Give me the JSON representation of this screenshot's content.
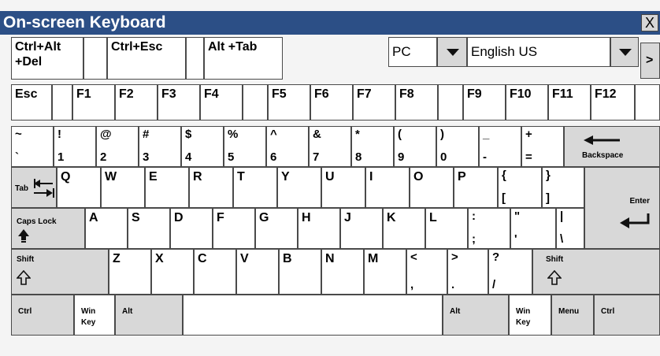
{
  "window": {
    "title": "On-screen Keyboard",
    "close": "X"
  },
  "toolbar": {
    "ctrl_alt_del": "Ctrl+Alt\n+Del",
    "ctrl_esc": "Ctrl+Esc",
    "alt_tab": "Alt +Tab",
    "platform_value": "PC",
    "language_value": "English US",
    "more": ">"
  },
  "frow": [
    "Esc",
    "F1",
    "F2",
    "F3",
    "F4",
    "F5",
    "F6",
    "F7",
    "F8",
    "F9",
    "F10",
    "F11",
    "F12"
  ],
  "num_row": [
    {
      "top": "~",
      "bottom": "`"
    },
    {
      "top": "!",
      "bottom": "1"
    },
    {
      "top": "@",
      "bottom": "2"
    },
    {
      "top": "#",
      "bottom": "3"
    },
    {
      "top": "$",
      "bottom": "4"
    },
    {
      "top": "%",
      "bottom": "5"
    },
    {
      "top": "^",
      "bottom": "6"
    },
    {
      "top": "&",
      "bottom": "7"
    },
    {
      "top": "*",
      "bottom": "8"
    },
    {
      "top": "(",
      "bottom": "9"
    },
    {
      "top": ")",
      "bottom": "0"
    },
    {
      "top": "_",
      "bottom": "-"
    },
    {
      "top": "+",
      "bottom": "="
    }
  ],
  "backspace": "Backspace",
  "tab": "Tab",
  "qrow": [
    "Q",
    "W",
    "E",
    "R",
    "T",
    "Y",
    "U",
    "I",
    "O",
    "P"
  ],
  "bracket_open": {
    "top": "{",
    "bottom": "["
  },
  "bracket_close": {
    "top": "}",
    "bottom": "]"
  },
  "enter": "Enter",
  "caps": "Caps Lock",
  "arow": [
    "A",
    "S",
    "D",
    "F",
    "G",
    "H",
    "J",
    "K",
    "L"
  ],
  "semicolon": {
    "top": ":",
    "bottom": ";"
  },
  "quote": {
    "top": "\"",
    "bottom": "'"
  },
  "backslash": {
    "top": "|",
    "bottom": "\\"
  },
  "shift": "Shift",
  "zrow": [
    "Z",
    "X",
    "C",
    "V",
    "B",
    "N",
    "M"
  ],
  "comma": {
    "top": "<",
    "bottom": ","
  },
  "period": {
    "top": ">",
    "bottom": "."
  },
  "slash": {
    "top": "?",
    "bottom": "/"
  },
  "bottom": {
    "ctrl": "Ctrl",
    "win": "Win\nKey",
    "alt": "Alt",
    "menu": "Menu"
  }
}
